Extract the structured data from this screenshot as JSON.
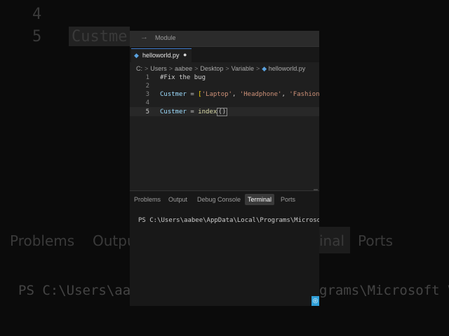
{
  "background": {
    "line_numbers": [
      "4",
      "5"
    ],
    "code_line": "Custmer",
    "panel_tabs": [
      "Problems",
      "Outpu",
      "inal",
      "Ports"
    ],
    "terminal_left": "PS C:\\Users\\aa",
    "terminal_right": "grams\\Microsoft VS"
  },
  "topbar": {
    "nav_arrow": "→",
    "search_text": "Module"
  },
  "tab": {
    "filename": "helloworld.py",
    "modified_dot": "●",
    "language_icon": "python-file-icon"
  },
  "breadcrumb": {
    "parts": [
      "C:",
      "Users",
      "aabee",
      "Desktop",
      "Variable",
      "helloworld.py"
    ],
    "separator": ">"
  },
  "editor": {
    "line_numbers": [
      "1",
      "2",
      "3",
      "4",
      "5"
    ],
    "line1_comment": "#Fix the bug",
    "line3_var": "Custmer",
    "line3_op": " = ",
    "line3_open": "[",
    "line3_items": [
      "'Laptop'",
      "'Headphone'",
      "'Fashion'"
    ],
    "line3_sep": ", ",
    "line3_close": "]",
    "line5_var": "Custmer",
    "line5_op": " = ",
    "line5_fn": "index",
    "line5_paren": "()"
  },
  "panel": {
    "tabs": [
      "Problems",
      "Output",
      "Debug Console",
      "Terminal",
      "Ports"
    ],
    "active_tab": "Terminal",
    "terminal_text": "PS C:\\Users\\aabee\\AppData\\Local\\Programs\\Microsoft VS"
  },
  "colors": {
    "accent": "#3e78c8",
    "string": "#ce9178",
    "variable": "#9cdcfe",
    "bracket": "#ffd700"
  }
}
